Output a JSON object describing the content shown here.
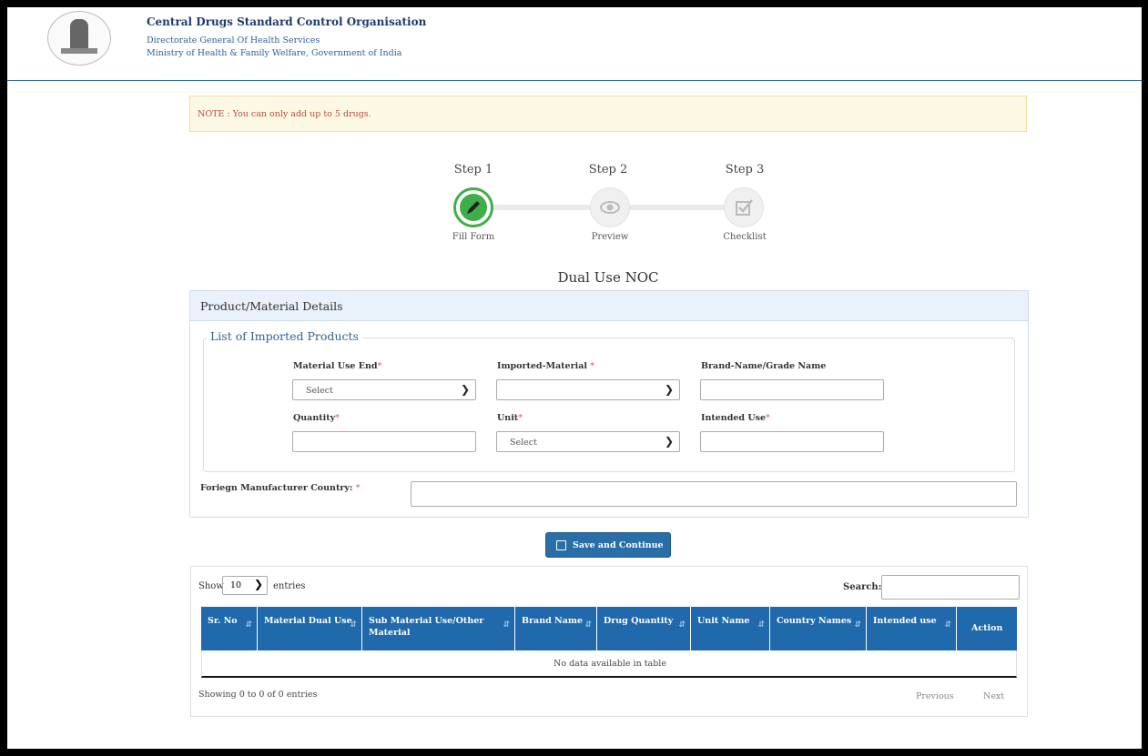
{
  "header": {
    "org_title": "Central Drugs Standard Control Organisation",
    "org_sub1": "Directorate General Of Health Services",
    "org_sub2": "Ministry of Health & Family Welfare, Government of India"
  },
  "note": "NOTE : You can only add up to 5 drugs.",
  "steps": [
    {
      "title": "Step 1",
      "label": "Fill Form",
      "icon": "pencil-icon"
    },
    {
      "title": "Step 2",
      "label": "Preview",
      "icon": "eye-icon"
    },
    {
      "title": "Step 3",
      "label": "Checklist",
      "icon": "checkbox-icon"
    }
  ],
  "page_title": "Dual Use NOC",
  "panel": {
    "heading": "Product/Material Details",
    "legend": "List of Imported Products",
    "fields": {
      "material_use_end": {
        "label": "Material Use End",
        "value": "Select"
      },
      "imported_material": {
        "label": "Imported-Material ",
        "value": ""
      },
      "brand_name": {
        "label": "Brand-Name/Grade Name",
        "value": ""
      },
      "quantity": {
        "label": "Quantity",
        "value": ""
      },
      "unit": {
        "label": "Unit",
        "value": "Select"
      },
      "intended_use": {
        "label": "Intended Use",
        "value": ""
      }
    },
    "foreign_country_label": "Foriegn Manufacturer Country: ",
    "required_mark": "*"
  },
  "save_button": "Save and Continue",
  "table": {
    "show_label": "Show",
    "entries_label": "entries",
    "page_length": "10",
    "search_label": "Search:",
    "columns": [
      "Sr. No",
      "Material Dual Use",
      "Sub Material Use/Other Material",
      "Brand Name",
      "Drug Quantity",
      "Unit Name",
      "Country Names",
      "Intended use",
      "Action"
    ],
    "empty_text": "No data available in table",
    "info": "Showing 0 to 0 of 0 entries",
    "previous": "Previous",
    "next": "Next"
  },
  "colors": {
    "header_blue": "#1f69ac",
    "step_active": "#3fae49",
    "note_bg": "#fcf8e3",
    "note_text": "#b94a48"
  }
}
